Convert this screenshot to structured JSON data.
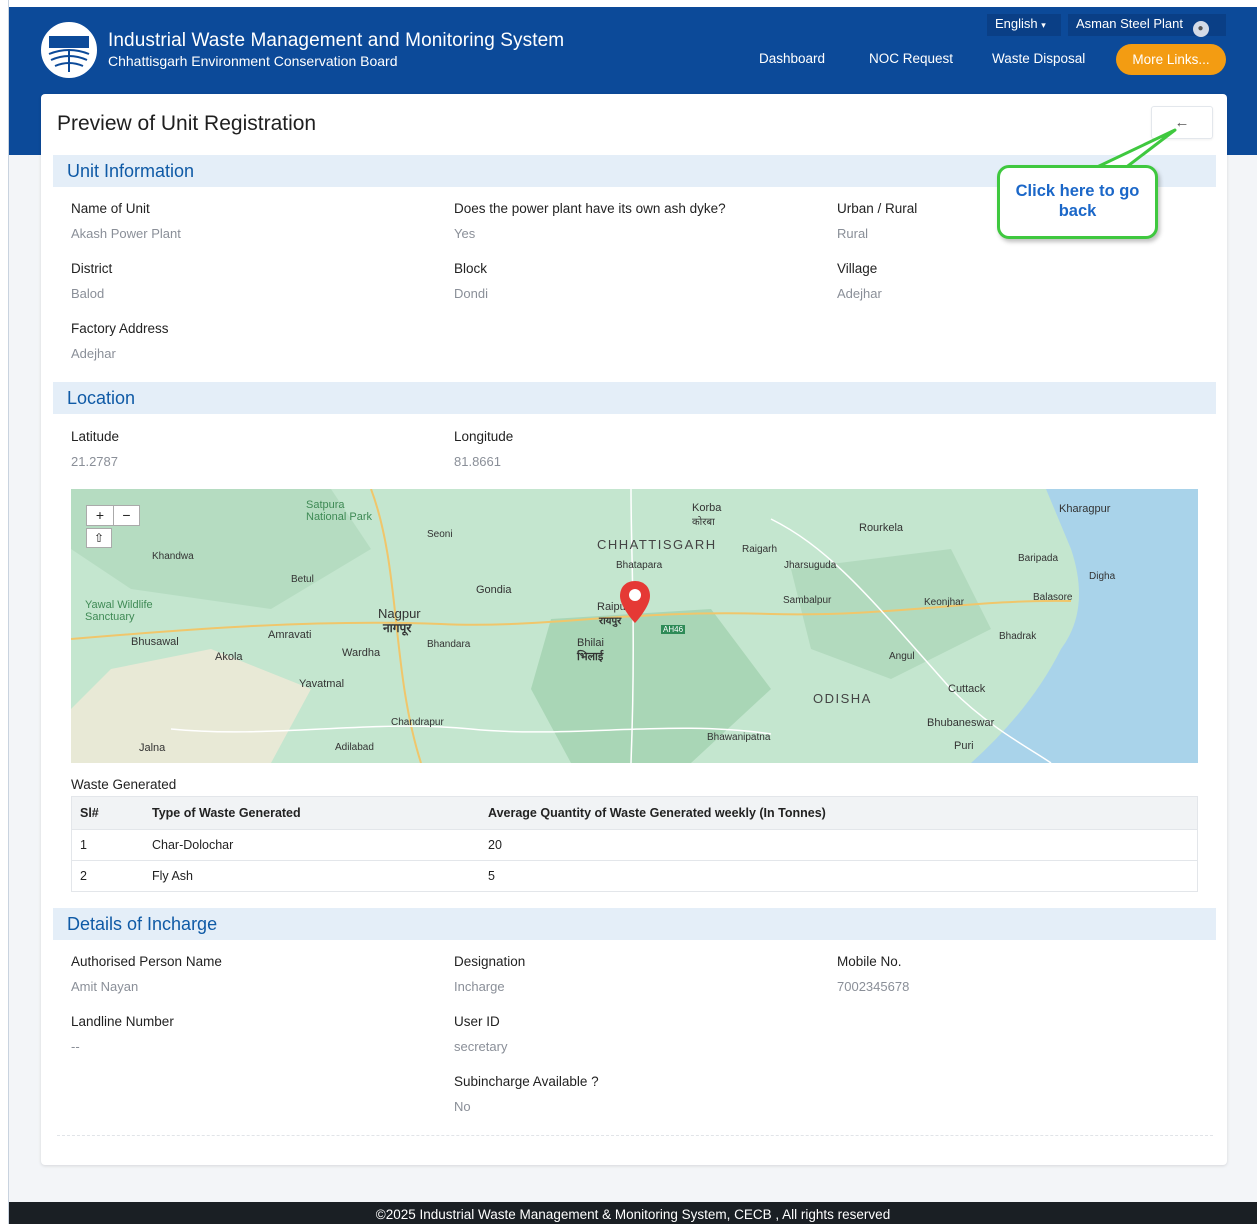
{
  "header": {
    "title": "Industrial Waste Management and Monitoring System",
    "subtitle": "Chhattisgarh Environment Conservation Board",
    "language": "English",
    "user": "Asman Steel Plant",
    "nav": [
      "Dashboard",
      "NOC Request",
      "Waste Disposal"
    ],
    "more_links": "More Links..."
  },
  "page": {
    "title": "Preview of Unit Registration",
    "back_symbol": "←",
    "callout": "Click here to go back"
  },
  "unit_info": {
    "heading": "Unit Information",
    "name_label": "Name of Unit",
    "name_value": "Akash Power Plant",
    "ash_label": "Does the power plant have its own ash dyke?",
    "ash_value": "Yes",
    "area_label": "Urban / Rural",
    "area_value": "Rural",
    "district_label": "District",
    "district_value": "Balod",
    "block_label": "Block",
    "block_value": "Dondi",
    "village_label": "Village",
    "village_value": "Adejhar",
    "address_label": "Factory Address",
    "address_value": "Adejhar"
  },
  "location": {
    "heading": "Location",
    "lat_label": "Latitude",
    "lat_value": "21.2787",
    "lng_label": "Longitude",
    "lng_value": "81.8661",
    "map_labels": [
      "Satpura National Park",
      "Korba",
      "कोरबा",
      "Rourkela",
      "Kharagpur",
      "CHHATTISGARH",
      "Raigarh",
      "Khandwa",
      "Seoni",
      "Betul",
      "Gondia",
      "Bhatapara",
      "Jharsuguda",
      "Baripada",
      "Digha",
      "Yawal Wildlife Sanctuary",
      "Nagpur",
      "नागपूर",
      "Raipur",
      "रायपुर",
      "Sambalpur",
      "Keonjhar",
      "Balasore",
      "Bhusawal",
      "Amravati",
      "Bhandara",
      "Bhilai",
      "भिलाई",
      "Akola",
      "Wardha",
      "Bhadrak",
      "Angul",
      "Yavatmal",
      "ODISHA",
      "Cuttack",
      "Chandrapur",
      "Bhubaneswar",
      "Jalna",
      "Adilabad",
      "Bhawanipatna",
      "Puri",
      "AH46"
    ],
    "zoom_in": "+",
    "zoom_out": "−",
    "compass": "⇧"
  },
  "waste": {
    "heading": "Waste Generated",
    "columns": [
      "Sl#",
      "Type of Waste Generated",
      "Average Quantity of Waste Generated weekly (In Tonnes)"
    ],
    "rows": [
      [
        "1",
        "Char-Dolochar",
        "20"
      ],
      [
        "2",
        "Fly Ash",
        "5"
      ]
    ]
  },
  "incharge": {
    "heading": "Details of Incharge",
    "person_label": "Authorised Person Name",
    "person_value": "Amit Nayan",
    "designation_label": "Designation",
    "designation_value": "Incharge",
    "mobile_label": "Mobile No.",
    "mobile_value": "7002345678",
    "landline_label": "Landline Number",
    "landline_value": "--",
    "userid_label": "User ID",
    "userid_value": "secretary",
    "sub_label": "Subincharge Available ?",
    "sub_value": "No"
  },
  "footer": "©2025 Industrial Waste Management & Monitoring System, CECB , All rights reserved",
  "colors": {
    "header_blue": "#0c4a99",
    "section_bg": "#e4eef8",
    "section_text": "#0f5aa6",
    "orange": "#f39c12",
    "callout_green": "#3fc83f",
    "pin_red": "#e53935"
  }
}
